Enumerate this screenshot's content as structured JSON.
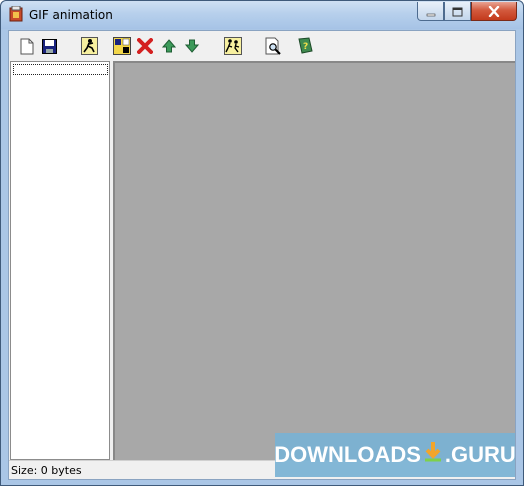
{
  "window": {
    "title": "GIF animation",
    "icon": "gif-app-icon"
  },
  "caption_buttons": [
    "minimize-icon",
    "maximize-icon",
    "close-icon"
  ],
  "toolbar": {
    "buttons": [
      {
        "icon": "new-document-icon"
      },
      {
        "icon": "save-disk-icon"
      },
      {
        "icon": "run-figure-icon"
      },
      {
        "icon": "add-frame-icon"
      },
      {
        "icon": "delete-x-icon"
      },
      {
        "icon": "move-up-arrow-icon"
      },
      {
        "icon": "move-down-arrow-icon"
      },
      {
        "icon": "animate-figures-icon"
      },
      {
        "icon": "preview-magnifier-icon"
      },
      {
        "icon": "help-book-icon"
      }
    ]
  },
  "status": {
    "text": "Size: 0 bytes"
  },
  "watermark": {
    "left": "DOWNLOADS",
    "right": ".GURU"
  },
  "colors": {
    "preview_bg": "#a8a8a8",
    "titlebar": "#b7d0ec",
    "close_button": "#c33a1c",
    "watermark_bg": "#7ab2d4"
  }
}
